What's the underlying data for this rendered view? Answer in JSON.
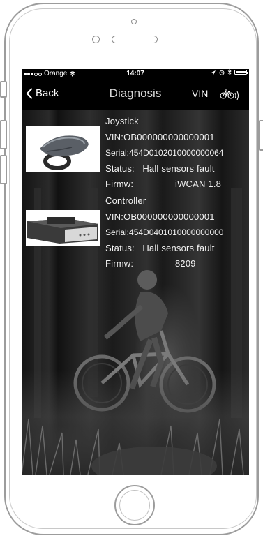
{
  "status_bar": {
    "carrier": "Orange",
    "time": "14:07"
  },
  "nav": {
    "back_label": "Back",
    "title": "Diagnosis",
    "vin_label": "VIN"
  },
  "devices": [
    {
      "name": "Joystick",
      "vin_label": "VIN:",
      "vin": "OB000000000000001",
      "serial_label": "Serial:",
      "serial": "454D0102010000000064",
      "status_label": "Status:",
      "status": "Hall sensors fault",
      "firmware_label": "Firmw:",
      "firmware": "iWCAN 1.8"
    },
    {
      "name": "Controller",
      "vin_label": "VIN:",
      "vin": "OB000000000000001",
      "serial_label": "Serial:",
      "serial": "454D0401010000000000",
      "status_label": "Status:",
      "status": "Hall sensors fault",
      "firmware_label": "Firmw:",
      "firmware": "8209"
    }
  ],
  "colors": {
    "bars": "#000000",
    "text": "#f2f2f2",
    "frame": "#9c9c9c"
  }
}
